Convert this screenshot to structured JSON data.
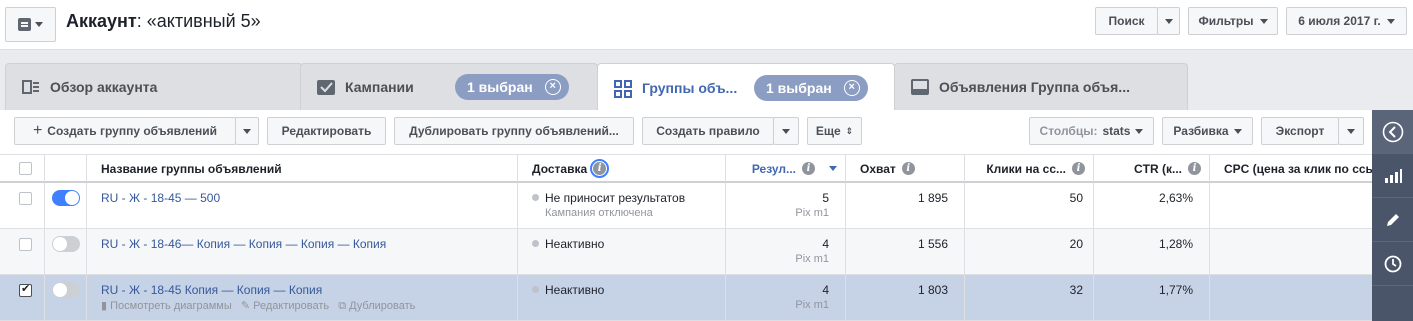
{
  "header": {
    "account_label": "Аккаунт",
    "account_name": ": «активный 5»",
    "search_label": "Поиск",
    "filters_label": "Фильтры",
    "date_label": "6 июля 2017 г."
  },
  "tabs": [
    {
      "label": "Обзор аккаунта",
      "icon": "overview-icon"
    },
    {
      "label": "Кампании",
      "icon": "campaign-check-icon",
      "badge": "1 выбран"
    },
    {
      "label": "Группы объ...",
      "icon": "grid-icon",
      "badge": "1 выбран",
      "active": true
    },
    {
      "label": "Объявления Группа объя...",
      "icon": "ad-icon"
    }
  ],
  "toolbar": {
    "create_label": "Создать группу объявлений",
    "edit_label": "Редактировать",
    "duplicate_label": "Дублировать группу объявлений...",
    "rule_label": "Создать правило",
    "more_label": "Еще",
    "columns_label": "Столбцы:",
    "columns_value": "stats",
    "breakdown_label": "Разбивка",
    "export_label": "Экспорт"
  },
  "table": {
    "columns": {
      "name": "Название группы объявлений",
      "delivery": "Доставка",
      "results": "Резул...",
      "reach": "Охват",
      "clicks": "Клики на сс...",
      "ctr": "CTR (к...",
      "cpc": "CPC (цена за клик по ссы"
    },
    "rows": [
      {
        "name": "RU - Ж - 18-45 — 500",
        "status": "Не приносит результатов",
        "status_sub": "Кампания отключена",
        "results": "5",
        "results_sub": "Pix m1",
        "reach": "1 895",
        "clicks": "50",
        "ctr": "2,63%",
        "active": true,
        "selected": false
      },
      {
        "name": "RU - Ж - 18-46— Копия — Копия — Копия — Копия",
        "status": "Неактивно",
        "status_sub": "",
        "results": "4",
        "results_sub": "Pix m1",
        "reach": "1 556",
        "clicks": "20",
        "ctr": "1,28%",
        "active": false,
        "selected": false
      },
      {
        "name": "RU - Ж - 18-45 Копия — Копия — Копия",
        "status": "Неактивно",
        "status_sub": "",
        "results": "4",
        "results_sub": "Pix m1",
        "reach": "1 803",
        "clicks": "32",
        "ctr": "1,77%",
        "active": false,
        "selected": true,
        "actions": {
          "charts": "Посмотреть диаграммы",
          "edit": "Редактировать",
          "duplicate": "Дублировать"
        }
      }
    ]
  },
  "colors": {
    "accent": "#4267b2",
    "toggle_on": "#4080ff",
    "selected_row": "#c6d3e7",
    "badge": "#8b9dc3",
    "side_panel": "#4b5569"
  }
}
